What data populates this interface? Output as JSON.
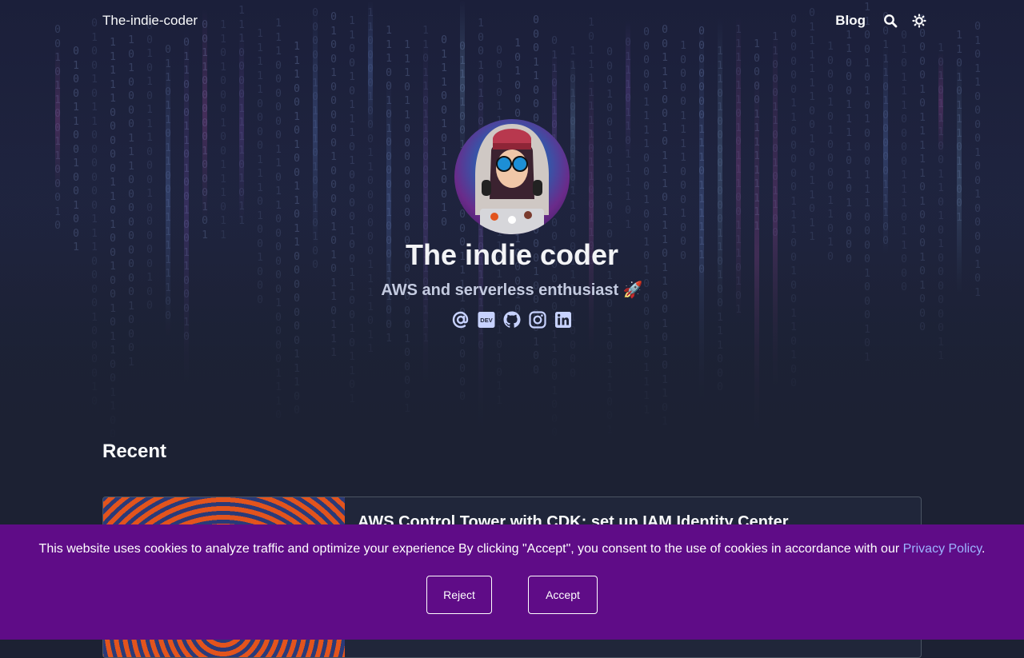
{
  "header": {
    "brand": "The-indie-coder",
    "nav_blog": "Blog",
    "search_icon": "search-icon",
    "theme_icon": "sun-icon"
  },
  "profile": {
    "title": "The indie coder",
    "subtitle": "AWS and serverless enthusiast 🚀",
    "socials": [
      {
        "name": "email",
        "icon": "at-icon"
      },
      {
        "name": "dev.to",
        "icon": "dev-icon"
      },
      {
        "name": "github",
        "icon": "github-icon"
      },
      {
        "name": "instagram",
        "icon": "instagram-icon"
      },
      {
        "name": "linkedin",
        "icon": "linkedin-icon"
      }
    ]
  },
  "recent": {
    "heading": "Recent",
    "posts": [
      {
        "title": "AWS Control Tower with CDK: set up IAM Identity Center"
      }
    ]
  },
  "cookie_banner": {
    "text": "This website uses cookies to analyze traffic and optimize your experience By clicking \"Accept\", you consent to the use of cookies in accordance with our ",
    "link": "Privacy Policy",
    "after_link": ".",
    "reject_label": "Reject",
    "accept_label": "Accept"
  },
  "colors": {
    "background": "#1c2133",
    "banner": "#5f0c87",
    "link": "#9db4ff",
    "icon": "#c7d2fe"
  }
}
